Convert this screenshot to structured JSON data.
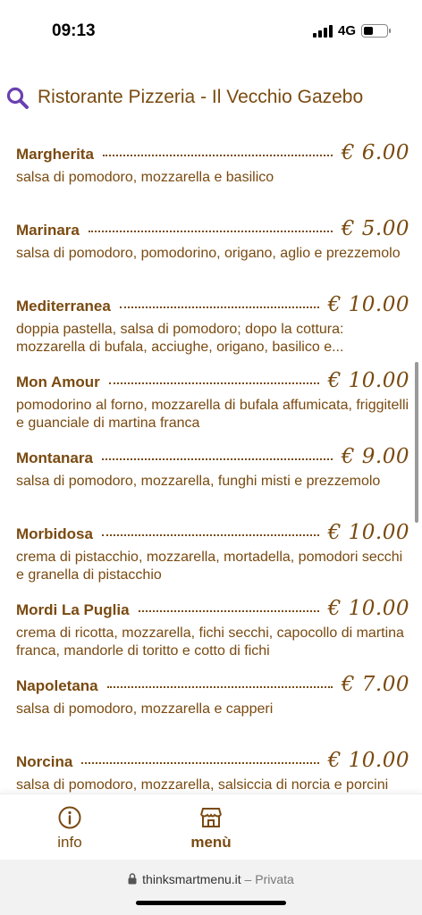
{
  "status_bar": {
    "time": "09:13",
    "network": "4G"
  },
  "header": {
    "title": "Ristorante Pizzeria - Il Vecchio Gazebo",
    "search_icon": "search-icon",
    "accent_color": "#7a4a10",
    "icon_color": "#6a3fb0"
  },
  "menu": {
    "items": [
      {
        "name": "Margherita",
        "price": "€ 6.00",
        "description": "salsa di pomodoro, mozzarella e basilico"
      },
      {
        "name": "Marinara",
        "price": "€ 5.00",
        "description": "salsa di pomodoro, pomodorino, origano, aglio e prezzemolo"
      },
      {
        "name": "Mediterranea",
        "price": "€ 10.00",
        "description": "doppia pastella, salsa di pomodoro; dopo la cottura: mozzarella di bufala, acciughe, origano, basilico e..."
      },
      {
        "name": "Mon Amour",
        "price": "€ 10.00",
        "description": "pomodorino al forno, mozzarella di bufala affumicata, friggitelli e guanciale di martina franca"
      },
      {
        "name": "Montanara",
        "price": "€ 9.00",
        "description": "salsa di pomodoro, mozzarella, funghi misti e prezzemolo"
      },
      {
        "name": "Morbidosa",
        "price": "€ 10.00",
        "description": "crema di pistacchio, mozzarella, mortadella, pomodori secchi e granella di pistacchio"
      },
      {
        "name": "Mordi La Puglia",
        "price": "€ 10.00",
        "description": "crema di ricotta, mozzarella, fichi secchi, capocollo di martina franca, mandorle di toritto e cotto di fichi"
      },
      {
        "name": "Napoletana",
        "price": "€ 7.00",
        "description": "salsa di pomodoro, mozzarella e capperi"
      },
      {
        "name": "Norcina",
        "price": "€ 10.00",
        "description": "salsa di pomodoro, mozzarella, salsiccia di norcia e porcini"
      }
    ]
  },
  "bottom_nav": {
    "info_label": "info",
    "info_icon": "info-icon",
    "menu_label": "menù",
    "menu_icon": "store-icon"
  },
  "browser": {
    "url": "thinksmartmenu.it",
    "separator": " – ",
    "privacy": "Privata"
  }
}
